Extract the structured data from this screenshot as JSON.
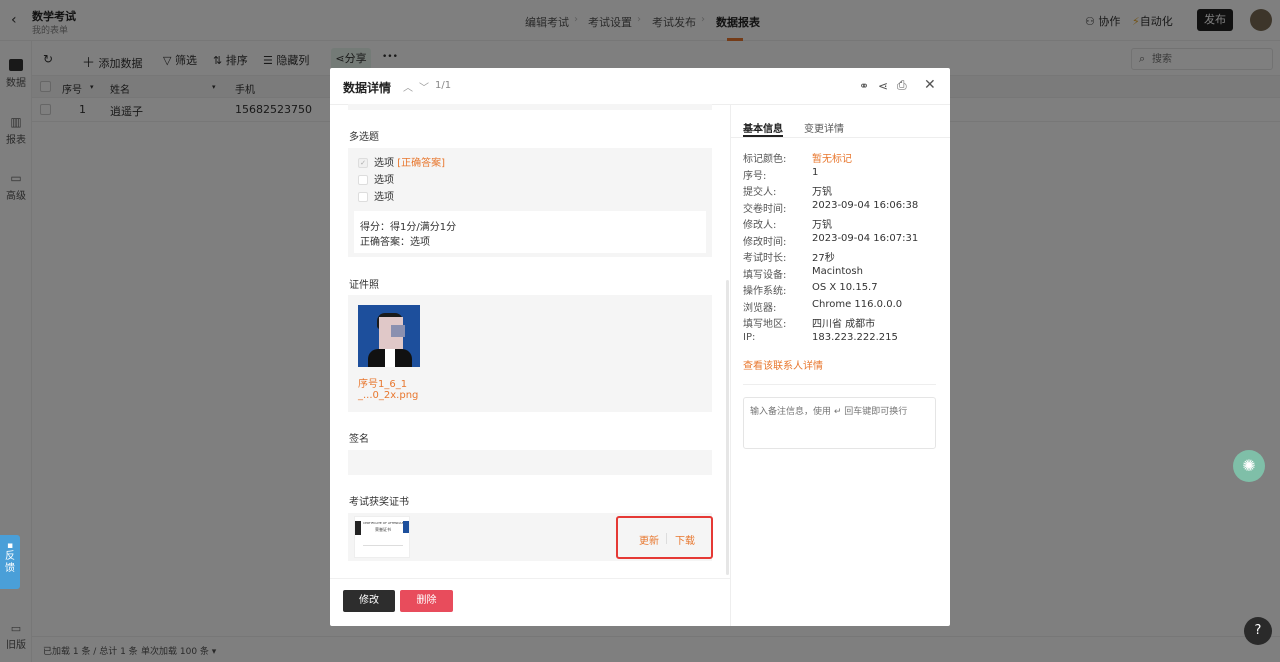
{
  "app": {
    "form_title": "数学考试",
    "form_subtitle": "我的表单",
    "tabs": [
      "编辑考试",
      "考试设置",
      "考试发布",
      "数据报表"
    ],
    "active_tab": 3,
    "collab_label": "协作",
    "auto_label": "自动化",
    "publish_label": "发布",
    "accent": "#e8772e"
  },
  "sidebar": {
    "items": [
      {
        "label": "数据",
        "icon": "table-icon"
      },
      {
        "label": "报表",
        "icon": "bar-chart-icon"
      },
      {
        "label": "高级",
        "icon": "monitor-icon"
      }
    ],
    "feedback_label": "反馈",
    "old_label": "旧版"
  },
  "toolbar": {
    "add_label": "添加数据",
    "filter_label": "筛选",
    "sort_label": "排序",
    "hide_label": "隐藏列",
    "share_label": "分享",
    "more_label": "•••",
    "search_placeholder": "搜索"
  },
  "grid": {
    "headers": [
      "序号",
      "姓名",
      "手机"
    ],
    "rows": [
      {
        "index": "1",
        "name": "逍遥子",
        "phone": "15682523750"
      }
    ]
  },
  "footer": {
    "loaded_text": "已加载 1 条 / 总计 1 条",
    "per_load_text": "单次加载 100 条"
  },
  "modal": {
    "title": "数据详情",
    "pager": "1/1",
    "multi": {
      "title": "多选题",
      "options": [
        {
          "label": "选项",
          "tag": "[正确答案]",
          "checked": true
        },
        {
          "label": "选项",
          "tag": "",
          "checked": false
        },
        {
          "label": "选项",
          "tag": "",
          "checked": false
        }
      ],
      "score": "得分：得1分/满分1分",
      "answer": "正确答案：选项"
    },
    "photo": {
      "title": "证件照",
      "filename_line1": "序号1_6_1",
      "filename_line2": "_...0_2x.png"
    },
    "signature": {
      "title": "签名"
    },
    "certificate": {
      "title": "考试获奖证书",
      "cert_heading": "CERTIFICATE OF ATTENDANCE",
      "cert_sub": "荣誉证书",
      "update_label": "更新",
      "download_label": "下载"
    },
    "edit_label": "修改",
    "delete_label": "删除",
    "right_tabs": [
      "基本信息",
      "变更详情"
    ],
    "info": [
      {
        "label": "标记颜色:",
        "value": "暂无标记"
      },
      {
        "label": "序号:",
        "value": "1"
      },
      {
        "label": "提交人:",
        "value": "万钒"
      },
      {
        "label": "交卷时间:",
        "value": "2023-09-04 16:06:38"
      },
      {
        "label": "修改人:",
        "value": "万钒"
      },
      {
        "label": "修改时间:",
        "value": "2023-09-04 16:07:31"
      },
      {
        "label": "考试时长:",
        "value": "27秒"
      },
      {
        "label": "填写设备:",
        "value": "Macintosh"
      },
      {
        "label": "操作系统:",
        "value": "OS X 10.15.7"
      },
      {
        "label": "浏览器:",
        "value": "Chrome 116.0.0.0"
      },
      {
        "label": "填写地区:",
        "value": "四川省 成都市"
      },
      {
        "label": "IP:",
        "value": "183.223.222.215"
      }
    ],
    "contact_link": "查看该联系人详情",
    "note_placeholder": "输入备注信息，使用 ↵ 回车键即可换行"
  }
}
